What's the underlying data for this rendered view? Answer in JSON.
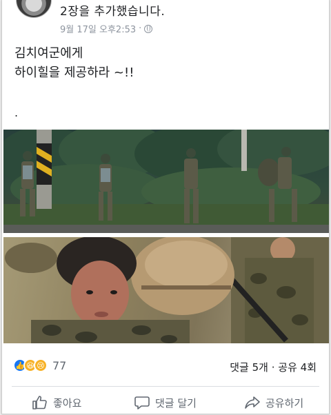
{
  "post": {
    "title": "2장을 추가했습니다.",
    "date": "9월 17일 오후2:53",
    "separator": "·",
    "text_line1": "김치여군에게",
    "text_line2": "하이힐을 제공하라 ~!!",
    "text_dot": "."
  },
  "reactions": {
    "count": "77",
    "types": [
      "like-icon",
      "haha-icon",
      "sad-icon"
    ]
  },
  "stats": {
    "comments": "댓글 5개",
    "dot": "·",
    "shares": "공유 4회"
  },
  "actions": {
    "like": "좋아요",
    "comment": "댓글 달기",
    "share": "공유하기"
  },
  "colors": {
    "accent": "#1877f2",
    "muted": "#8d949e"
  }
}
